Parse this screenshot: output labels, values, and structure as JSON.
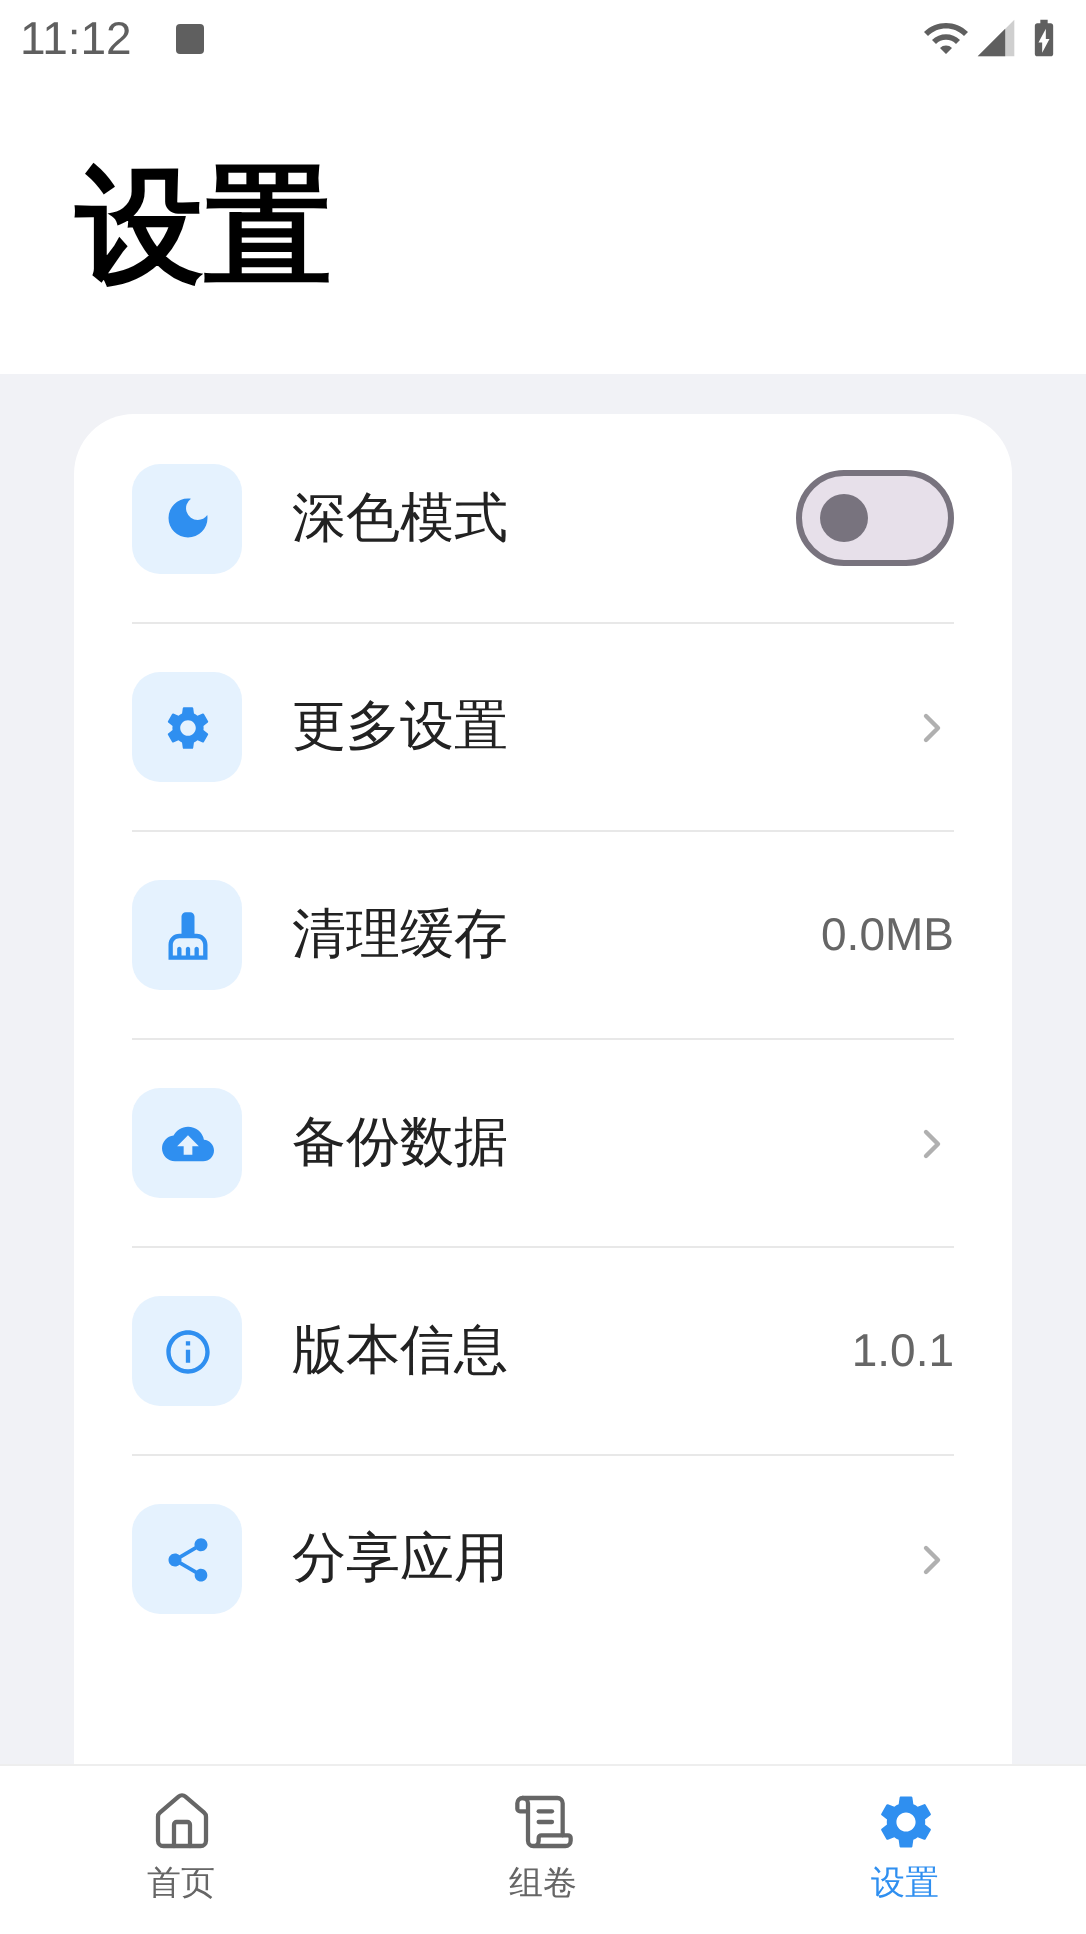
{
  "status_bar": {
    "time": "11:12"
  },
  "title": "设置",
  "settings": [
    {
      "kind": "toggle",
      "label": "深色模式",
      "on": false
    },
    {
      "kind": "link",
      "label": "更多设置"
    },
    {
      "kind": "value",
      "label": "清理缓存",
      "value": "0.0MB"
    },
    {
      "kind": "link",
      "label": "备份数据"
    },
    {
      "kind": "value",
      "label": "版本信息",
      "value": "1.0.1"
    },
    {
      "kind": "link",
      "label": "分享应用"
    }
  ],
  "tabs": [
    {
      "label": "首页",
      "selected": false
    },
    {
      "label": "组卷",
      "selected": false
    },
    {
      "label": "设置",
      "selected": true
    }
  ]
}
